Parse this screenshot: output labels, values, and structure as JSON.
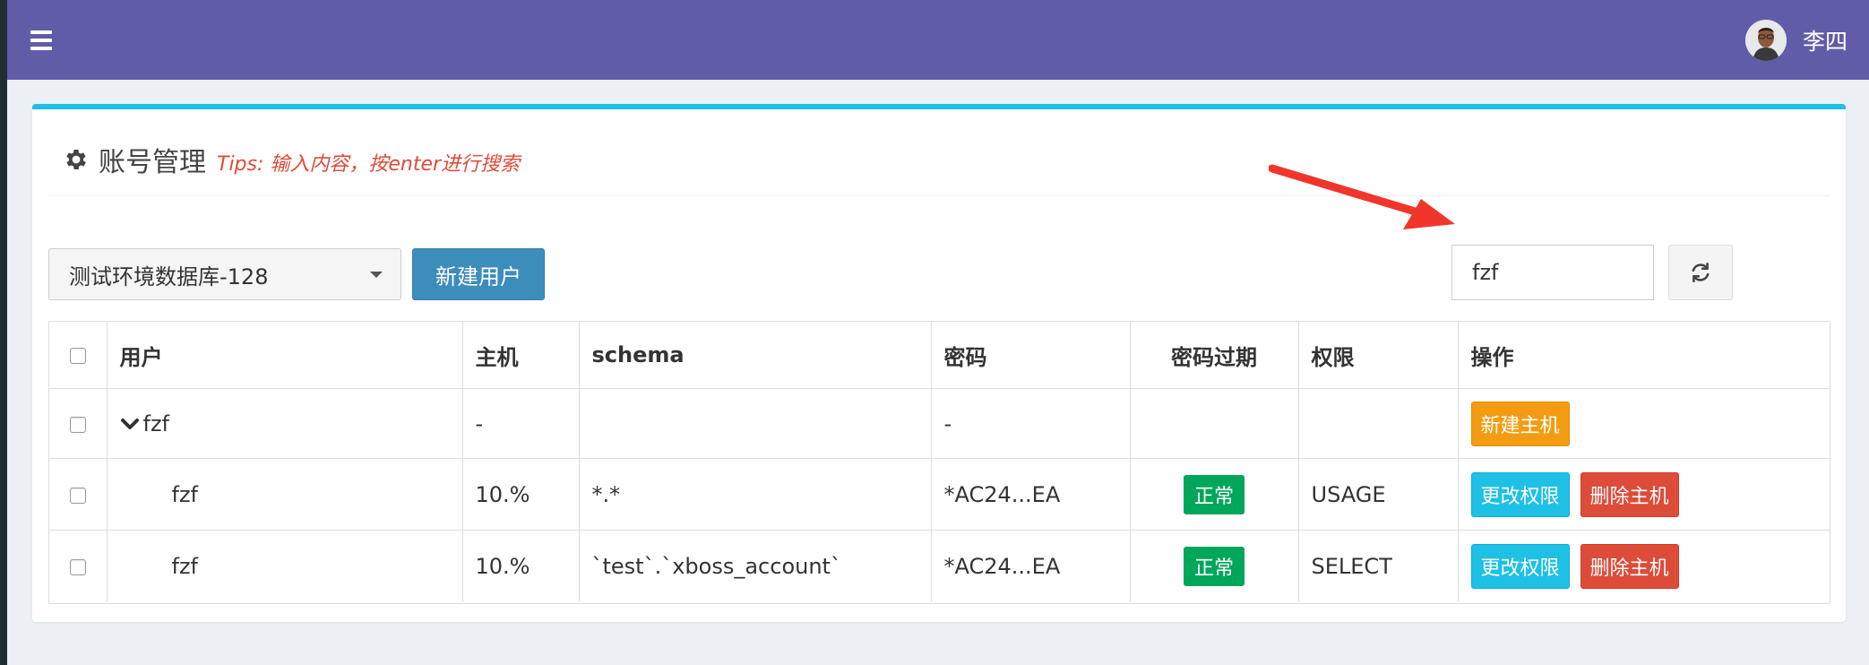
{
  "header": {
    "username": "李四"
  },
  "panel": {
    "title": "账号管理",
    "tips": "Tips: 输入内容，按enter进行搜索"
  },
  "toolbar": {
    "database_selected": "测试环境数据库-128",
    "new_user_label": "新建用户",
    "search_value": "fzf"
  },
  "table": {
    "headers": [
      "用户",
      "主机",
      "schema",
      "密码",
      "密码过期",
      "权限",
      "操作"
    ],
    "group": {
      "user": "fzf",
      "host": "-",
      "schema": "",
      "password": "-",
      "expired": "",
      "privilege": "",
      "action": "新建主机"
    },
    "rows": [
      {
        "user": "fzf",
        "host": "10.%",
        "schema": "*.*",
        "password": "*AC24...EA",
        "expired": "正常",
        "privilege": "USAGE",
        "action_edit": "更改权限",
        "action_delete": "删除主机"
      },
      {
        "user": "fzf",
        "host": "10.%",
        "schema": "`test`.`xboss_account`",
        "password": "*AC24...EA",
        "expired": "正常",
        "privilege": "SELECT",
        "action_edit": "更改权限",
        "action_delete": "删除主机"
      }
    ]
  },
  "colors": {
    "header_bg": "#605ca8",
    "accent": "#1ec0e6",
    "primary": "#3c8dbc",
    "success": "#00a65a",
    "warning": "#f39c12",
    "danger": "#dd4b39"
  },
  "icons": [
    "hamburger-icon",
    "gear-icon",
    "caret-down-icon",
    "refresh-icon",
    "chevron-down-icon"
  ]
}
